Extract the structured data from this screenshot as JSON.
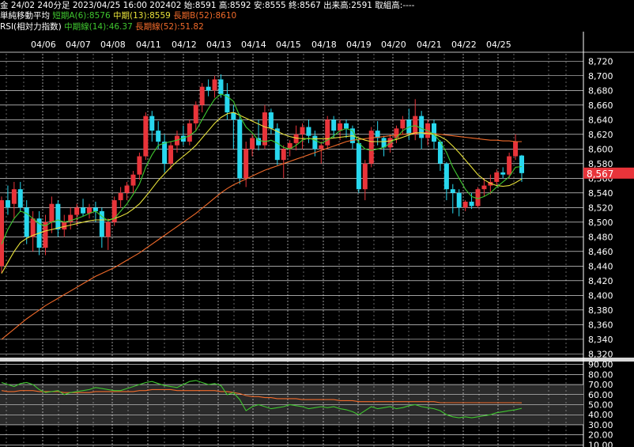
{
  "header": {
    "line1": {
      "instrument": "金 24/02 240分足",
      "datetime": "2023/04/25 16:00",
      "contract": "202402",
      "open_label": "始:8591",
      "high_label": "高:8592",
      "low_label": "安:8555",
      "close_label": "終:8567",
      "volume_label": "出来高:2591",
      "oi_label": "取組高:----"
    },
    "line2": {
      "title": "単純移動平均",
      "short": "短期A(6):8576",
      "mid": "中期(13):8559",
      "long": "長期B(52):8610"
    },
    "line3": {
      "title": "RSI(相対力指数)",
      "mid": "中期線(14):46.37",
      "long": "長期線(52):51.82"
    }
  },
  "colors": {
    "background": "#000000",
    "grid": "#ffffff",
    "up_candle": "#e8343a",
    "down_candle": "#28d7ee",
    "ma_short": "#3fc62f",
    "ma_mid": "#e8e23a",
    "ma_long": "#f06a2a",
    "rsi_mid": "#3fc62f",
    "rsi_long": "#f06a2a",
    "price_tag_bg": "#e8343a"
  },
  "chart_data": [
    {
      "type": "candlestick",
      "dates": [
        "04/06",
        "04/07",
        "04/08",
        "04/11",
        "04/12",
        "04/13",
        "04/14",
        "04/15",
        "04/18",
        "04/19",
        "04/20",
        "04/21",
        "04/22",
        "04/25"
      ],
      "y_ticks": [
        "8,720",
        "8,700",
        "8,680",
        "8,660",
        "8,640",
        "8,620",
        "8,600",
        "8,580",
        "8,560",
        "8,540",
        "8,520",
        "8,500",
        "8,480",
        "8,460",
        "8,440",
        "8,420",
        "8,400",
        "8,380",
        "8,360",
        "8,340",
        "8,320"
      ],
      "ylim": [
        8315,
        8730
      ],
      "last_price_label": "8,567",
      "candles": [
        [
          8440,
          8535,
          8430,
          8530
        ],
        [
          8530,
          8550,
          8510,
          8520
        ],
        [
          8525,
          8555,
          8505,
          8545
        ],
        [
          8545,
          8555,
          8515,
          8520
        ],
        [
          8520,
          8530,
          8470,
          8480
        ],
        [
          8480,
          8515,
          8460,
          8505
        ],
        [
          8505,
          8515,
          8455,
          8465
        ],
        [
          8465,
          8510,
          8455,
          8500
        ],
        [
          8500,
          8535,
          8485,
          8525
        ],
        [
          8525,
          8530,
          8480,
          8490
        ],
        [
          8490,
          8510,
          8480,
          8500
        ],
        [
          8500,
          8520,
          8490,
          8510
        ],
        [
          8510,
          8525,
          8495,
          8520
        ],
        [
          8520,
          8532,
          8508,
          8512
        ],
        [
          8512,
          8525,
          8505,
          8520
        ],
        [
          8520,
          8528,
          8500,
          8515
        ],
        [
          8515,
          8520,
          8465,
          8480
        ],
        [
          8480,
          8505,
          8462,
          8500
        ],
        [
          8500,
          8535,
          8495,
          8530
        ],
        [
          8530,
          8548,
          8520,
          8540
        ],
        [
          8540,
          8555,
          8530,
          8550
        ],
        [
          8550,
          8570,
          8540,
          8565
        ],
        [
          8565,
          8595,
          8558,
          8590
        ],
        [
          8590,
          8650,
          8585,
          8645
        ],
        [
          8645,
          8652,
          8610,
          8625
        ],
        [
          8625,
          8638,
          8600,
          8610
        ],
        [
          8610,
          8620,
          8568,
          8580
        ],
        [
          8580,
          8610,
          8572,
          8605
        ],
        [
          8605,
          8625,
          8595,
          8618
        ],
        [
          8618,
          8632,
          8605,
          8610
        ],
        [
          8610,
          8640,
          8605,
          8635
        ],
        [
          8635,
          8665,
          8625,
          8660
        ],
        [
          8660,
          8690,
          8650,
          8685
        ],
        [
          8685,
          8695,
          8672,
          8680
        ],
        [
          8680,
          8700,
          8670,
          8695
        ],
        [
          8695,
          8702,
          8670,
          8675
        ],
        [
          8675,
          8690,
          8640,
          8650
        ],
        [
          8650,
          8660,
          8600,
          8640
        ],
        [
          8640,
          8648,
          8552,
          8560
        ],
        [
          8560,
          8610,
          8548,
          8600
        ],
        [
          8600,
          8620,
          8590,
          8615
        ],
        [
          8615,
          8640,
          8598,
          8605
        ],
        [
          8605,
          8660,
          8600,
          8650
        ],
        [
          8650,
          8655,
          8620,
          8628
        ],
        [
          8628,
          8635,
          8578,
          8585
        ],
        [
          8585,
          8605,
          8560,
          8600
        ],
        [
          8600,
          8612,
          8590,
          8608
        ],
        [
          8608,
          8632,
          8598,
          8620
        ],
        [
          8620,
          8635,
          8600,
          8630
        ],
        [
          8630,
          8640,
          8608,
          8618
        ],
        [
          8618,
          8625,
          8590,
          8600
        ],
        [
          8600,
          8610,
          8580,
          8605
        ],
        [
          8605,
          8645,
          8600,
          8640
        ],
        [
          8640,
          8645,
          8615,
          8625
        ],
        [
          8625,
          8640,
          8612,
          8635
        ],
        [
          8635,
          8640,
          8615,
          8628
        ],
        [
          8628,
          8632,
          8600,
          8608
        ],
        [
          8608,
          8615,
          8540,
          8545
        ],
        [
          8545,
          8585,
          8530,
          8580
        ],
        [
          8580,
          8630,
          8575,
          8625
        ],
        [
          8625,
          8638,
          8605,
          8615
        ],
        [
          8615,
          8618,
          8590,
          8602
        ],
        [
          8602,
          8620,
          8595,
          8615
        ],
        [
          8615,
          8632,
          8608,
          8628
        ],
        [
          8628,
          8645,
          8620,
          8640
        ],
        [
          8640,
          8655,
          8612,
          8620
        ],
        [
          8620,
          8668,
          8612,
          8645
        ],
        [
          8645,
          8652,
          8600,
          8615
        ],
        [
          8615,
          8640,
          8605,
          8635
        ],
        [
          8635,
          8640,
          8600,
          8610
        ],
        [
          8610,
          8612,
          8570,
          8580
        ],
        [
          8580,
          8582,
          8530,
          8545
        ],
        [
          8545,
          8552,
          8512,
          8540
        ],
        [
          8540,
          8545,
          8508,
          8520
        ],
        [
          8520,
          8530,
          8515,
          8528
        ],
        [
          8528,
          8540,
          8518,
          8522
        ],
        [
          8522,
          8548,
          8520,
          8545
        ],
        [
          8545,
          8560,
          8535,
          8550
        ],
        [
          8550,
          8565,
          8538,
          8555
        ],
        [
          8555,
          8572,
          8550,
          8568
        ],
        [
          8568,
          8575,
          8560,
          8565
        ],
        [
          8565,
          8595,
          8560,
          8590
        ],
        [
          8590,
          8620,
          8585,
          8610
        ],
        [
          8591,
          8592,
          8555,
          8567
        ]
      ],
      "ma_short": [
        8470,
        8490,
        8505,
        8515,
        8512,
        8505,
        8498,
        8495,
        8500,
        8503,
        8500,
        8502,
        8505,
        8508,
        8512,
        8515,
        8508,
        8502,
        8505,
        8515,
        8525,
        8538,
        8552,
        8575,
        8592,
        8605,
        8608,
        8610,
        8612,
        8615,
        8618,
        8625,
        8640,
        8655,
        8668,
        8675,
        8672,
        8665,
        8645,
        8630,
        8622,
        8612,
        8610,
        8612,
        8608,
        8602,
        8600,
        8605,
        8612,
        8615,
        8612,
        8608,
        8612,
        8618,
        8625,
        8628,
        8625,
        8608,
        8600,
        8598,
        8600,
        8602,
        8608,
        8615,
        8625,
        8630,
        8632,
        8628,
        8625,
        8620,
        8610,
        8595,
        8575,
        8560,
        8545,
        8535,
        8532,
        8535,
        8540,
        8548,
        8555,
        8562,
        8575,
        8576
      ],
      "ma_mid": [
        8430,
        8445,
        8460,
        8472,
        8478,
        8482,
        8485,
        8488,
        8490,
        8492,
        8494,
        8496,
        8498,
        8500,
        8502,
        8503,
        8503,
        8503,
        8505,
        8508,
        8512,
        8518,
        8525,
        8535,
        8546,
        8557,
        8566,
        8575,
        8583,
        8590,
        8597,
        8605,
        8615,
        8625,
        8635,
        8643,
        8648,
        8650,
        8646,
        8642,
        8638,
        8634,
        8630,
        8628,
        8624,
        8620,
        8617,
        8615,
        8614,
        8614,
        8614,
        8614,
        8614,
        8615,
        8616,
        8617,
        8618,
        8615,
        8612,
        8610,
        8610,
        8610,
        8611,
        8613,
        8616,
        8619,
        8622,
        8622,
        8621,
        8620,
        8617,
        8612,
        8604,
        8595,
        8585,
        8575,
        8565,
        8558,
        8553,
        8550,
        8549,
        8550,
        8554,
        8559
      ],
      "ma_long": [
        8340,
        8347,
        8354,
        8361,
        8368,
        8374,
        8380,
        8386,
        8391,
        8396,
        8401,
        8406,
        8411,
        8416,
        8421,
        8426,
        8430,
        8434,
        8438,
        8443,
        8448,
        8453,
        8458,
        8464,
        8470,
        8476,
        8482,
        8488,
        8494,
        8500,
        8506,
        8512,
        8519,
        8526,
        8533,
        8540,
        8546,
        8551,
        8555,
        8559,
        8563,
        8567,
        8571,
        8574,
        8577,
        8580,
        8583,
        8586,
        8589,
        8592,
        8595,
        8598,
        8601,
        8604,
        8607,
        8610,
        8612,
        8613,
        8614,
        8615,
        8616,
        8617,
        8618,
        8619,
        8620,
        8621,
        8622,
        8622,
        8622,
        8621,
        8620,
        8619,
        8618,
        8617,
        8616,
        8615,
        8614,
        8613,
        8612,
        8612,
        8611,
        8611,
        8610,
        8610
      ]
    },
    {
      "type": "line",
      "title": "RSI",
      "y_ticks": [
        "90.00",
        "80.00",
        "70.00",
        "60.00",
        "50.00",
        "40.00",
        "30.00",
        "20.00",
        "10.00"
      ],
      "ylim": [
        8,
        92
      ],
      "band": [
        30,
        70
      ],
      "series": [
        {
          "name": "中期線(14)",
          "values": [
            72,
            70,
            68,
            71,
            72,
            70,
            65,
            62,
            63,
            64,
            60,
            62,
            63,
            64,
            65,
            67,
            66,
            65,
            64,
            64,
            66,
            68,
            70,
            72,
            73,
            71,
            69,
            68,
            67,
            70,
            73,
            74,
            72,
            70,
            71,
            69,
            60,
            62,
            55,
            44,
            48,
            50,
            48,
            46,
            47,
            48,
            50,
            49,
            48,
            46,
            47,
            48,
            47,
            48,
            46,
            45,
            43,
            40,
            44,
            48,
            46,
            47,
            48,
            46,
            47,
            49,
            50,
            48,
            47,
            46,
            44,
            40,
            38,
            37,
            38,
            37,
            38,
            39,
            40,
            42,
            43,
            44,
            45,
            46.37
          ]
        },
        {
          "name": "長期線(52)",
          "values": [
            64,
            63,
            63,
            64,
            64,
            64,
            63,
            63,
            63,
            63,
            62,
            62,
            62,
            62,
            62,
            63,
            63,
            63,
            63,
            63,
            63,
            63,
            64,
            64,
            65,
            65,
            65,
            65,
            64,
            64,
            64,
            64,
            64,
            64,
            64,
            63,
            63,
            62,
            61,
            59,
            58,
            58,
            57,
            57,
            56,
            56,
            56,
            56,
            55,
            55,
            55,
            55,
            55,
            55,
            54,
            54,
            54,
            53,
            53,
            53,
            53,
            53,
            53,
            53,
            53,
            53,
            53,
            53,
            53,
            53,
            52,
            52,
            52,
            52,
            52,
            52,
            52,
            52,
            52,
            52,
            52,
            52,
            52,
            51.82
          ]
        }
      ]
    }
  ]
}
